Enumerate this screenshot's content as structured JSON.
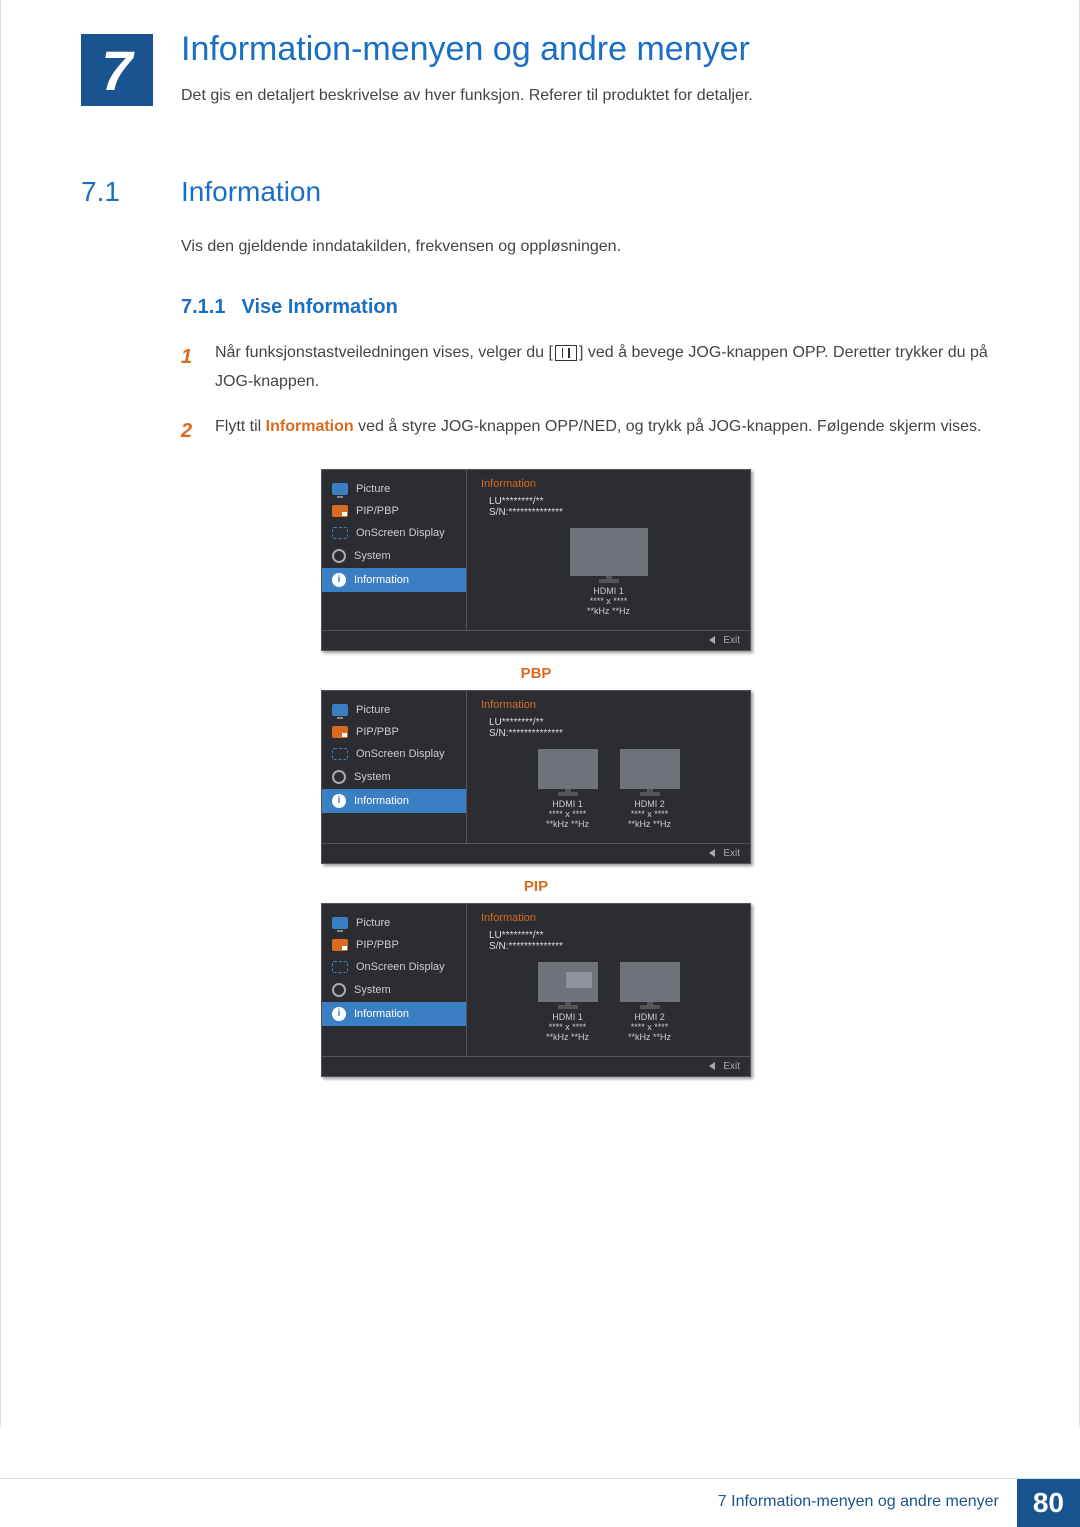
{
  "chapter": {
    "number": "7",
    "title": "Information-menyen og andre menyer",
    "description": "Det gis en detaljert beskrivelse av hver funksjon. Referer til produktet for detaljer."
  },
  "section": {
    "number": "7.1",
    "title": "Information",
    "paragraph": "Vis den gjeldende inndatakilden, frekvensen og oppløsningen."
  },
  "subsection": {
    "number": "7.1.1",
    "title": "Vise Information"
  },
  "steps": {
    "s1": {
      "num": "1",
      "pre": "Når funksjonstastveiledningen vises, velger du [",
      "post": "] ved å bevege JOG-knappen OPP. Deretter trykker du på JOG-knappen."
    },
    "s2": {
      "num": "2",
      "pre": "Flytt til ",
      "hl": "Information",
      "post": " ved å styre JOG-knappen OPP/NED, og trykk på JOG-knappen. Følgende skjerm vises."
    }
  },
  "osd": {
    "menu": {
      "picture": "Picture",
      "pip": "PIP/PBP",
      "onscreen": "OnScreen Display",
      "system": "System",
      "information": "Information"
    },
    "panel": {
      "title": "Information",
      "model": "LU********/**",
      "serial": "S/N:**************"
    },
    "signal": {
      "hdmi1": "HDMI 1",
      "hdmi2": "HDMI 2",
      "res": "**** x ****",
      "freq": "**kHz **Hz"
    },
    "exit": "Exit"
  },
  "labels": {
    "pbp": "PBP",
    "pip": "PIP"
  },
  "footer": {
    "chapter_ref": "7",
    "chapter_title": "Information-menyen og andre menyer",
    "page": "80"
  }
}
